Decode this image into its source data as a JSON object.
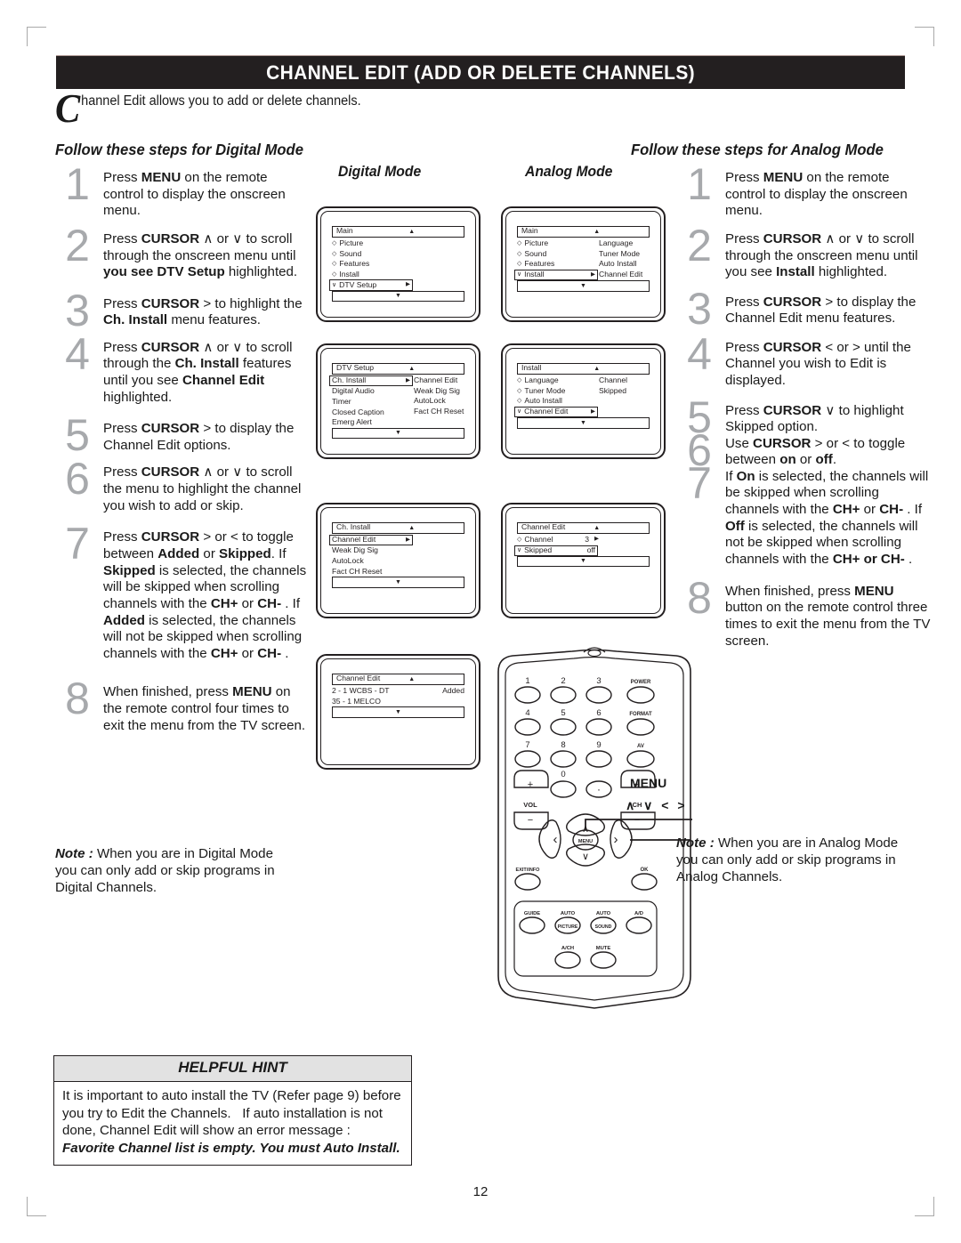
{
  "header": {
    "title": "CHANNEL EDIT (ADD OR DELETE CHANNELS)",
    "intro_dropcap": "C",
    "intro_text": "hannel Edit allows you to add or delete channels."
  },
  "sections": {
    "digital_heading": "Follow these steps for Digital Mode",
    "analog_heading": "Follow these steps for Analog Mode"
  },
  "digital_steps": [
    {
      "num": "1",
      "html": "Press <b>MENU</b> on the remote  control to display the onscreen menu."
    },
    {
      "num": "2",
      "html": "Press <b>CURSOR</b> ∧ or ∨ to scroll through the onscreen menu until <b>you see DTV Setup</b> highlighted."
    },
    {
      "num": "3",
      "html": "Press <b>CURSOR</b> &gt; to highlight the <b>Ch. Install</b> menu features."
    },
    {
      "num": "4",
      "html": "Press <b>CURSOR</b> ∧ or ∨ to scroll through the <b>Ch. Install</b> features until you see <b>Channel Edit</b> highlighted."
    },
    {
      "num": "5",
      "html": "Press <b>CURSOR</b> &gt;  to display the Channel Edit options."
    },
    {
      "num": "6",
      "html": "Press <b>CURSOR</b> ∧ or ∨ to scroll the menu to highlight the channel you wish to add or skip."
    },
    {
      "num": "7",
      "html": "Press <b>CURSOR</b>  &gt; or &lt; to toggle between <b>Added</b> or <b>Skipped</b>. If <b>Skipped</b> is selected,  the channels will be skipped when scrolling channels with the <b>CH+</b> or <b>CH-</b> .  If <b>Added</b> is selected, the channels will not be skipped when scrolling channels with the <b>CH+</b> or <b>CH-</b> ."
    },
    {
      "num": "8",
      "html": "When finished, press <b>MENU</b> on the remote control  four times to exit the menu from the TV screen."
    }
  ],
  "analog_steps": [
    {
      "num": "1",
      "html": "Press <b>MENU</b> on the remote  control to display the onscreen menu."
    },
    {
      "num": "2",
      "html": "Press <b>CURSOR</b> ∧ or ∨ to scroll through the onscreen menu until you see <b>Install</b> highlighted."
    },
    {
      "num": "3",
      "html": "Press <b>CURSOR</b>  &gt; to display the Channel Edit menu features."
    },
    {
      "num": "4",
      "html": "Press <b>CURSOR</b> &lt; or &gt; until the Channel you wish to Edit is displayed."
    },
    {
      "num": "5",
      "html": "Press <b>CURSOR</b> ∨ to highlight Skipped option."
    },
    {
      "num": "6",
      "html": "Use <b>CURSOR</b> &gt; or &lt;  to toggle between <b>on</b> or <b>off</b>."
    },
    {
      "num": "7",
      "html": "If <b>On</b> is selected, the channels  will be skipped when scrolling&nbsp;&nbsp;&nbsp;&nbsp;&nbsp;&nbsp;&nbsp; channels with the <b>CH+</b> or <b>CH-</b> .   If <b>Off</b> is selected, the channels will not be skipped when scrolling channels with the <b>CH+ or CH-</b> ."
    },
    {
      "num": "8",
      "html": "When finished, press <b>MENU</b> button on the remote control three times to exit the menu from the TV screen."
    }
  ],
  "notes": {
    "digital": "When you are in Digital Mode you can only add or skip programs in Digital Channels.",
    "analog": "When you are in Analog Mode you can only add or skip programs in Analog Channels.",
    "label": "Note :"
  },
  "osd": {
    "digital_label": "Digital Mode",
    "analog_label": "Analog Mode",
    "digital_screens": [
      {
        "title": "Main",
        "col1": [
          {
            "mark": "◇",
            "text": "Picture",
            "sel": false
          },
          {
            "mark": "◇",
            "text": "Sound",
            "sel": false
          },
          {
            "mark": "◇",
            "text": "Features",
            "sel": false
          },
          {
            "mark": "◇",
            "text": "Install",
            "sel": false
          },
          {
            "mark": "∨",
            "text": "DTV Setup",
            "sel": true,
            "arrow": "▶"
          }
        ],
        "col2": []
      },
      {
        "title": "DTV Setup",
        "col1": [
          {
            "mark": "",
            "text": "Ch. Install",
            "sel": true,
            "arrow": "▶"
          },
          {
            "mark": "",
            "text": "Digital Audio",
            "sel": false
          },
          {
            "mark": "",
            "text": "Timer",
            "sel": false
          },
          {
            "mark": "",
            "text": "Closed Caption",
            "sel": false
          },
          {
            "mark": "",
            "text": "Emerg Alert",
            "sel": false
          }
        ],
        "col2": [
          "Channel Edit",
          "Weak Dig Sig",
          "AutoLock",
          "Fact CH Reset"
        ]
      },
      {
        "title": "Ch. Install",
        "col1": [
          {
            "mark": "",
            "text": "Channel Edit",
            "sel": true,
            "arrow": "▶"
          },
          {
            "mark": "",
            "text": "Weak Dig Sig",
            "sel": false
          },
          {
            "mark": "",
            "text": "AutoLock",
            "sel": false
          },
          {
            "mark": "",
            "text": "Fact CH Reset",
            "sel": false
          }
        ],
        "col2": []
      },
      {
        "title": "Channel Edit",
        "channels": [
          {
            "ch": "2  -  1 WCBS - DT",
            "state": "Added"
          },
          {
            "ch": "35 -  1 MELCO",
            "state": ""
          }
        ]
      }
    ],
    "analog_screens": [
      {
        "title": "Main",
        "col1": [
          {
            "mark": "◇",
            "text": "Picture",
            "sel": false
          },
          {
            "mark": "◇",
            "text": "Sound",
            "sel": false
          },
          {
            "mark": "◇",
            "text": "Features",
            "sel": false
          },
          {
            "mark": "∨",
            "text": "Install",
            "sel": true,
            "arrow": "▶"
          }
        ],
        "col2": [
          "Language",
          "Tuner Mode",
          "Auto Install",
          "Channel Edit"
        ]
      },
      {
        "title": "Install",
        "col1": [
          {
            "mark": "◇",
            "text": "Language",
            "sel": false
          },
          {
            "mark": "◇",
            "text": "Tuner Mode",
            "sel": false
          },
          {
            "mark": "◇",
            "text": "Auto Install",
            "sel": false
          },
          {
            "mark": "∨",
            "text": "Channel Edit",
            "sel": true,
            "arrow": "▶"
          }
        ],
        "col2": [
          "Channel",
          "Skipped"
        ]
      },
      {
        "title": "Channel Edit",
        "col1": [
          {
            "mark": "◇",
            "text": "Channel",
            "sel": false,
            "value": "3",
            "arrow": "▶"
          },
          {
            "mark": "∨",
            "text": "Skipped",
            "sel": true,
            "value": "off"
          }
        ],
        "col2": []
      }
    ]
  },
  "remote": {
    "keys_row1": [
      "1",
      "2",
      "3",
      "POWER"
    ],
    "keys_row2": [
      "4",
      "5",
      "6",
      "FORMAT"
    ],
    "keys_row3": [
      "7",
      "8",
      "9",
      "AV"
    ],
    "keys_row4": [
      "0",
      "·"
    ],
    "vol_label": "VOL",
    "ch_label": "CH",
    "plus": "+",
    "minus": "−",
    "menu_label": "MENU",
    "exit_label": "EXIT/INFO",
    "ok_label": "OK",
    "bottom_row1": [
      "GUIDE",
      "AUTO",
      "AUTO",
      "A/D"
    ],
    "bottom_row1_sub": [
      "",
      "PICTURE",
      "SOUND",
      ""
    ],
    "bottom_row2": [
      "A/CH",
      "MUTE"
    ],
    "callout_menu": "MENU",
    "callout_cursor": "∧ ∨ < >"
  },
  "hint": {
    "title": "HELPFUL HINT",
    "body_html": "It is important to auto install the TV (Refer page 9) before you try to Edit the Channels.&nbsp;&nbsp; If auto installation is not done, Channel Edit will show an error message :&nbsp; <i>Favorite Channel list is empty. You must Auto Install.</i>"
  },
  "page_number": "12",
  "colors": {
    "title_bar": "#231f20",
    "step_number": "#a7a9ac",
    "hint_header": "#e2e2e2",
    "corner_mark": "#a9a9a9"
  }
}
